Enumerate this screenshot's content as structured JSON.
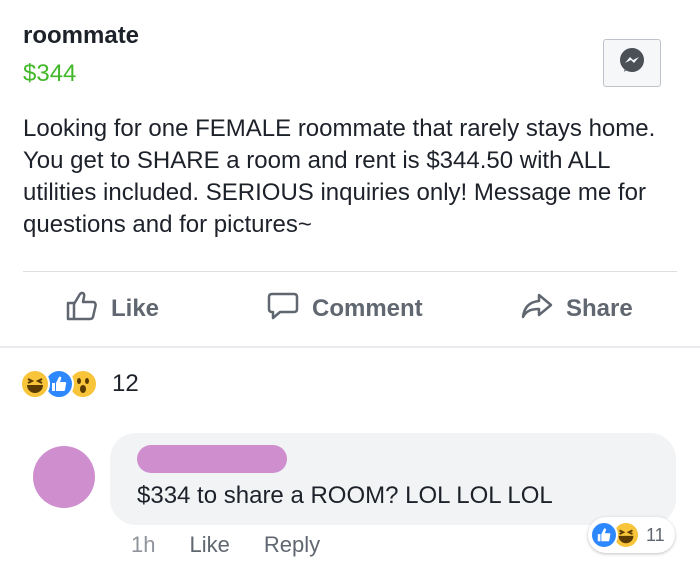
{
  "listing": {
    "title": "roommate",
    "price": "$344",
    "description": "Looking for one FEMALE roommate that rarely stays home. You get to SHARE a room and rent is $344.50 with ALL utilities included. SERIOUS inquiries only! Message me for questions and for pictures~",
    "messenger_icon": "messenger-icon"
  },
  "actions": {
    "like": "Like",
    "comment": "Comment",
    "share": "Share"
  },
  "reactions": {
    "icons": [
      "haha-icon",
      "like-icon",
      "wow-icon"
    ],
    "count": "12"
  },
  "comment": {
    "text": "$334 to share a ROOM?  LOL LOL LOL",
    "time": "1h",
    "like_label": "Like",
    "reply_label": "Reply",
    "reaction_icons": [
      "like-icon",
      "haha-icon"
    ],
    "reaction_count": "11"
  },
  "colors": {
    "price_green": "#42b72a",
    "redaction_pink": "#cf8fcf",
    "like_blue": "#2d88ff",
    "emoji_yellow": "#f7c43a"
  }
}
